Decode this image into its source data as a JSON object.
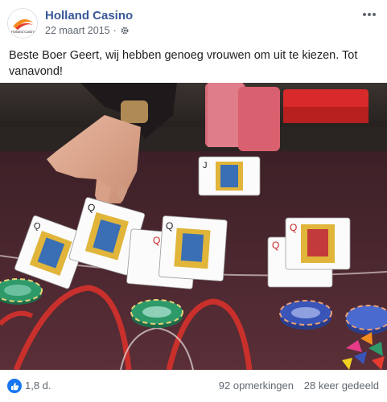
{
  "post": {
    "page_name": "Holland Casino",
    "date": "22 maart 2015",
    "separator": "·",
    "text": "Beste Boer Geert, wij hebben genoeg vrouwen om uit te kiezen. Tot vanavond!",
    "avatar_logo_text": "Holland Casino",
    "privacy_icon": "gear-icon",
    "more_icon": "more-options-icon"
  },
  "footer": {
    "reactions_count": "1,8 d.",
    "comments": "92 opmerkingen",
    "shares": "28 keer gedeeld",
    "like_color": "#1877f2"
  },
  "colors": {
    "link": "#385898",
    "meta": "#606770",
    "felt": "#4a2730"
  }
}
